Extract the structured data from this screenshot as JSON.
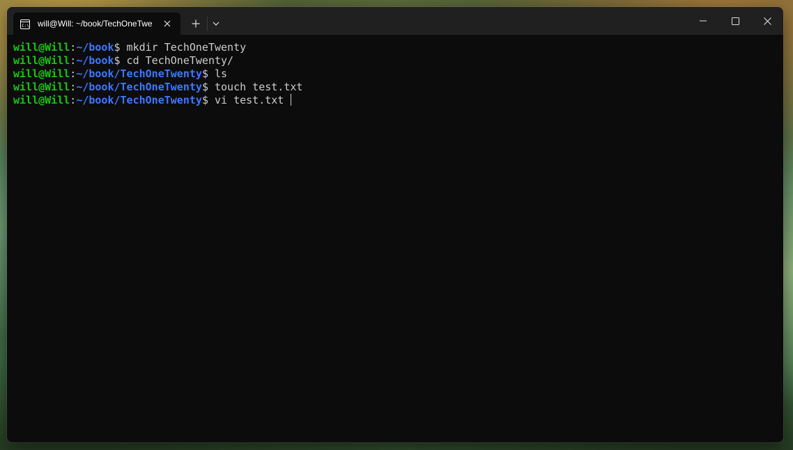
{
  "window": {
    "tab_title": "will@Will: ~/book/TechOneTwenty",
    "tab_icon": "terminal-icon",
    "new_tab_icon": "plus-icon",
    "dropdown_icon": "chevron-down-icon",
    "controls": [
      "minimize-icon",
      "maximize-icon",
      "close-icon"
    ]
  },
  "terminal": {
    "lines": [
      {
        "user": "will@Will",
        "sep": ":",
        "path": "~/book",
        "cmd": "$ mkdir TechOneTwenty"
      },
      {
        "user": "will@Will",
        "sep": ":",
        "path": "~/book",
        "cmd": "$ cd TechOneTwenty/"
      },
      {
        "user": "will@Will",
        "sep": ":",
        "path": "~/book/TechOneTwenty",
        "cmd": "$ ls"
      },
      {
        "user": "will@Will",
        "sep": ":",
        "path": "~/book/TechOneTwenty",
        "cmd": "$ touch test.txt"
      },
      {
        "user": "will@Will",
        "sep": ":",
        "path": "~/book/TechOneTwenty",
        "cmd": "$ vi test.txt "
      }
    ]
  },
  "colors": {
    "user": "#16c60c",
    "path": "#3b78ff",
    "text": "#cccccc",
    "background": "#0c0c0c",
    "titlebar": "#202020"
  }
}
